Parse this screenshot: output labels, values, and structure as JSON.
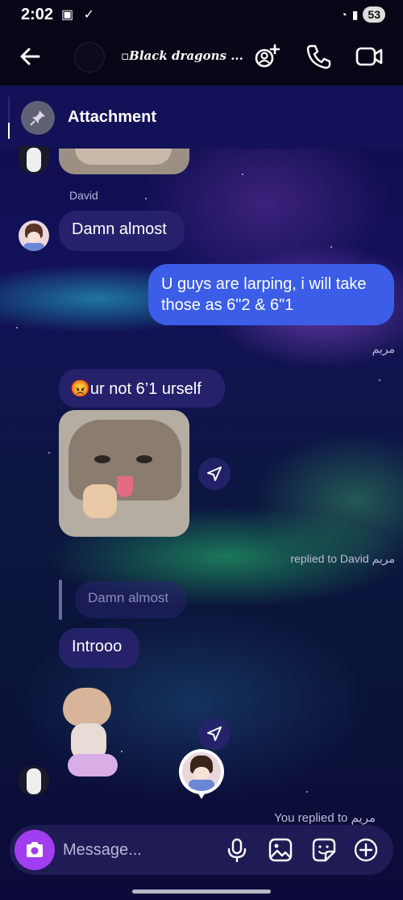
{
  "status_bar": {
    "time": "2:02",
    "battery": "53"
  },
  "header": {
    "title": "Black dragons ..."
  },
  "pinned": {
    "label": "Attachment"
  },
  "messages": {
    "sender_david": "David",
    "david_msg": "Damn almost",
    "out_msg": "U guys are larping, i will take those as 6\"2 & 6\"1",
    "out_meta": "مريم",
    "maryam_msg": "ur not 6’1 urself",
    "maryam_emoji": "😡",
    "replied_meta": "replied to David مريم",
    "quoted_text": "Damn almost",
    "reply_msg": "Introoo",
    "you_replied_meta": "You replied to مريم"
  },
  "composer": {
    "placeholder": "Message..."
  },
  "icons": {
    "back": "arrow-left-icon",
    "add_people": "add-people-icon",
    "call": "phone-icon",
    "video": "video-camera-icon",
    "pin": "pin-icon",
    "share": "paper-plane-icon",
    "camera": "camera-icon",
    "mic": "microphone-icon",
    "gallery": "image-icon",
    "sticker": "sticker-icon",
    "plus": "plus-circle-icon"
  },
  "colors": {
    "outgoing_bubble": "#3b5de8",
    "camera_button": "#a13ef0",
    "pinned_bar": "#131157"
  }
}
